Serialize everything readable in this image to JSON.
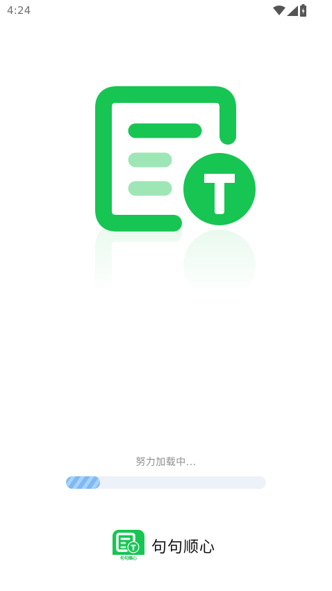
{
  "status_bar": {
    "time": "4:24",
    "icons": [
      "wifi-icon",
      "cellular-signal-icon",
      "battery-charging-icon"
    ]
  },
  "hero": {
    "logo_icon": "document-t-icon",
    "logo_letter": "T",
    "colors": {
      "brand_green": "#17c553",
      "light_green": "#9ee6b6",
      "white": "#ffffff"
    }
  },
  "loading": {
    "text": "努力加载中...",
    "progress_fraction": 0.17,
    "track_color": "#edf1f8",
    "fill_color": "#7fb9f2"
  },
  "brand": {
    "name": "句句顺心",
    "logo_small_text": "句句顺心",
    "logo_letter": "T"
  }
}
